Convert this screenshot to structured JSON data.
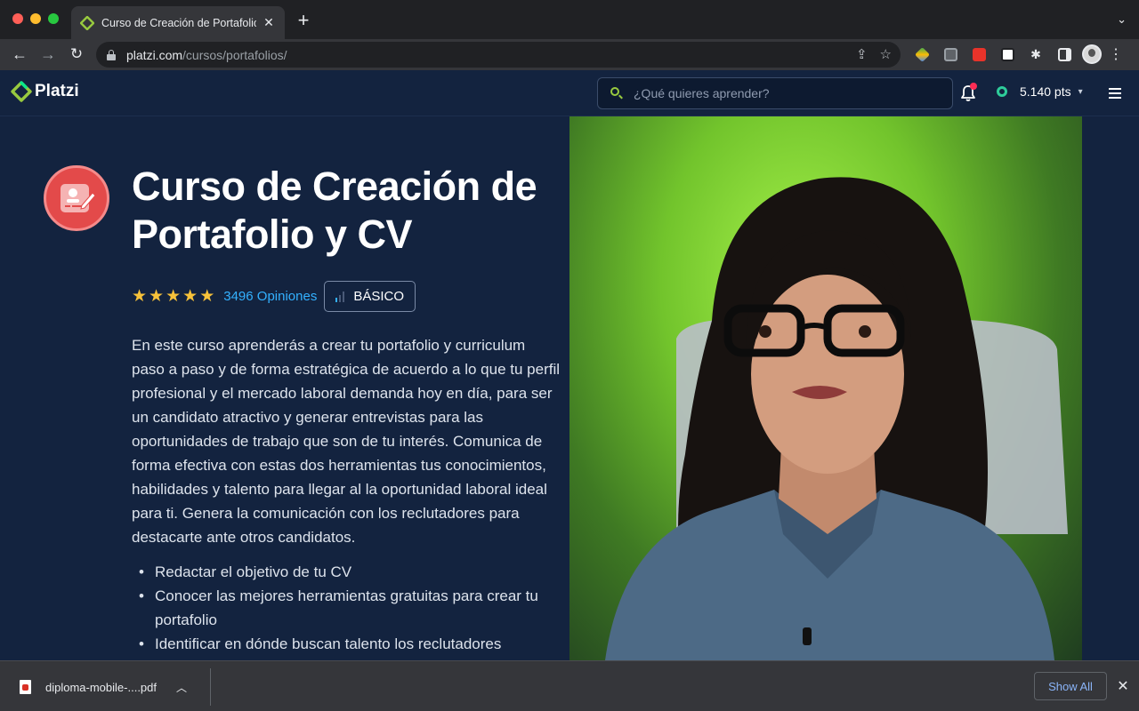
{
  "browser": {
    "tab": {
      "title": "Curso de Creación de Portafolio"
    },
    "address_bar": {
      "host": "platzi.com",
      "path": "/cursos/portafolios/"
    }
  },
  "site": {
    "logo_text": "Platzi",
    "search": {
      "placeholder": "¿Qué quieres aprender?"
    },
    "points": "5.140 pts"
  },
  "course": {
    "title": "Curso de Creación de Portafolio y CV",
    "rating_stars": 5,
    "reviews": "3496 Opiniones",
    "level": "BÁSICO",
    "description": "En este curso aprenderás a crear tu portafolio y curriculum paso a paso y de forma estratégica de acuerdo a lo que tu perfil profesional y el mercado laboral demanda hoy en día, para ser un candidato atractivo y generar entrevistas para las oportunidades de trabajo que son de tu interés. Comunica de forma efectiva con estas dos herramientas tus conocimientos, habilidades y talento para llegar al la oportunidad laboral ideal para ti. Genera la comunicación con los reclutadores para destacarte ante otros candidatos.",
    "objectives": [
      "Redactar el objetivo de tu CV",
      "Conocer las mejores herramientas gratuitas para crear tu portafolio",
      "Identificar en dónde buscan talento los reclutadores"
    ]
  },
  "downloads": {
    "file_name": "diploma-mobile-....pdf",
    "show_all": "Show All"
  },
  "colors": {
    "page_bg": "#13233f",
    "accent_green": "#98ca3f",
    "link_blue": "#33b1ff",
    "star_yellow": "#f7c23a",
    "badge_red": "#e34a4a"
  }
}
